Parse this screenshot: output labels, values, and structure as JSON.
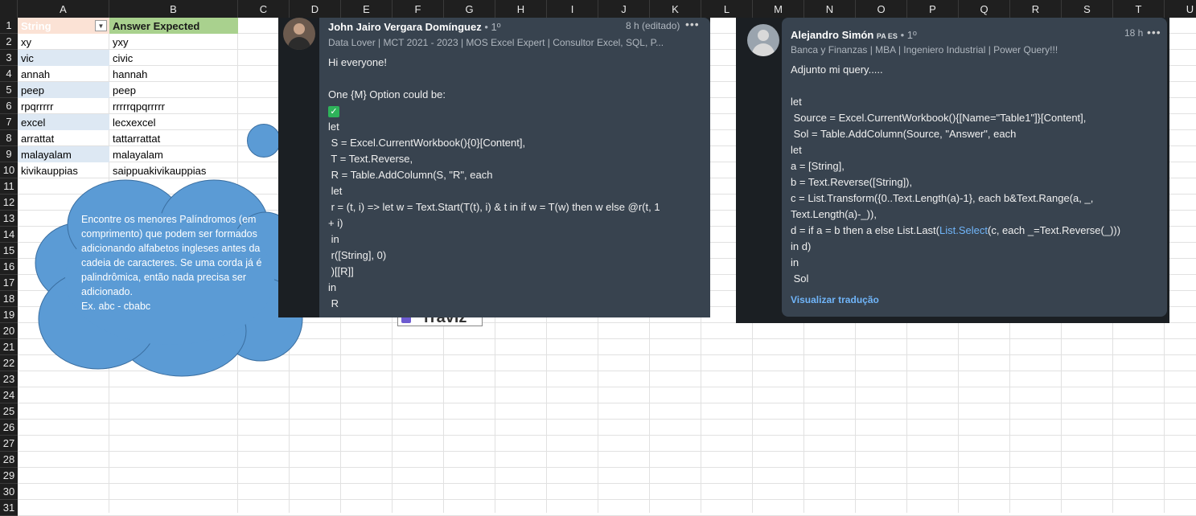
{
  "columns": [
    "A",
    "B",
    "C",
    "D",
    "E",
    "F",
    "G",
    "H",
    "I",
    "J",
    "K",
    "L",
    "M",
    "N",
    "O",
    "P",
    "Q",
    "R",
    "S",
    "T",
    "U"
  ],
  "rows": [
    "1",
    "2",
    "3",
    "4",
    "5",
    "6",
    "7",
    "8",
    "9",
    "10",
    "11",
    "12",
    "13",
    "14",
    "15",
    "16",
    "17",
    "18",
    "19",
    "20",
    "21",
    "22",
    "23",
    "24",
    "25",
    "26",
    "27",
    "28",
    "29",
    "30",
    "31"
  ],
  "table": {
    "header_a": "String",
    "header_b": "Answer Expected",
    "rows": [
      {
        "a": "xy",
        "b": "yxy"
      },
      {
        "a": "vic",
        "b": "civic"
      },
      {
        "a": "annah",
        "b": "hannah"
      },
      {
        "a": "peep",
        "b": "peep"
      },
      {
        "a": "rpqrrrrr",
        "b": "rrrrrqpqrrrrr"
      },
      {
        "a": "excel",
        "b": "lecxexcel"
      },
      {
        "a": "arrattat",
        "b": "tattarrattat"
      },
      {
        "a": "malayalam",
        "b": "malayalam"
      },
      {
        "a": "kivikauppias",
        "b": "saippuakivikauppias"
      }
    ]
  },
  "cloud_text": "Encontre os menores Palíndromos (em comprimento) que podem ser formados adicionando alfabetos ingleses antes da cadeia de caracteres. Se uma corda já é palindrômica, então nada precisa ser adicionado.\nEx. abc - cbabc",
  "logo_text": "rraviz",
  "post1": {
    "name": "John Jairo Vergara Domínguez",
    "degree": "• 1º",
    "time": "8 h (editado)",
    "more": "•••",
    "subtitle": "Data Lover | MCT 2021 - 2023 | MOS Excel Expert | Consultor Excel, SQL, P...",
    "line_greeting": "Hi everyone!",
    "line_option": "One {M} Option could be:",
    "check_icon": "✓",
    "code": "let\n S = Excel.CurrentWorkbook(){0}[Content],\n T = Text.Reverse,\n R = Table.AddColumn(S, \"R\", each\n let\n r = (t, i) => let w = Text.Start(T(t), i) & t in if w = T(w) then w else @r(t, 1\n+ i)\n in\n r([String], 0)\n )[[R]]\nin\n R"
  },
  "post2": {
    "name": "Alejandro Simón",
    "flags": "PA ES",
    "degree": "• 1º",
    "time": "18 h",
    "more": "•••",
    "subtitle": "Banca y Finanzas | MBA | Ingeniero Industrial | Power Query!!!",
    "intro": "Adjunto mi query.....",
    "code_before": "let\n Source = Excel.CurrentWorkbook(){[Name=\"Table1\"]}[Content],\n Sol = Table.AddColumn(Source, \"Answer\", each\nlet\na = [String],\nb = Text.Reverse([String]),\nc = List.Transform({0..Text.Length(a)-1}, each b&Text.Range(a, _,\nText.Length(a)-_)),\nd = if a = b then a else List.Last(",
    "code_link": "List.Select",
    "code_after": "(c, each _=Text.Reverse(_)))\nin d)\nin\n Sol",
    "translate": "Visualizar tradução"
  }
}
